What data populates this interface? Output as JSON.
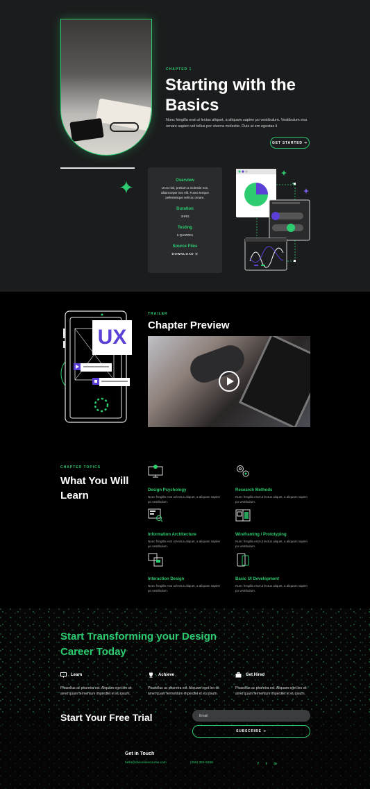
{
  "hero": {
    "eyebrow": "CHAPTER 1",
    "title_line1": "Starting with the",
    "title_line2": "Basics",
    "description": "Nunc fringilla erat ut lectus aliquet, a aliquam sapien po vestibulum. Vestibulum esa ornare sapien vel tellus por viverra molestie. Duis at em egestas li",
    "button_label": "GET STARTED ➔"
  },
  "details_card": {
    "overview_title": "Overview",
    "overview_text": "Ut ex nisl, pretium a molestie non, ullamcorper nec elit. Fusce tempor pellentesque velit ac ornare.",
    "duration_title": "Duration",
    "duration_value": "2HRS",
    "testing_title": "Testing",
    "testing_value": "5 QUIZZES",
    "source_title": "Source Files",
    "download_label": "DOWNLOAD ⊙"
  },
  "trailer": {
    "eyebrow": "TRAILER",
    "title": "Chapter Preview",
    "phone_badge": "UX"
  },
  "topics": {
    "eyebrow": "CHAPTER TOPICS",
    "title_line1": "What You Will",
    "title_line2": "Learn",
    "items": [
      {
        "title": "Design Psychology",
        "text": "Nunc fringilla erat ut lectus aliquet, a aliquam sapien po vestibulum.",
        "icon": "monitor-icon"
      },
      {
        "title": "Research Methods",
        "text": "Nunc fringilla erat ut lectus aliquet, a aliquam sapien po vestibulum.",
        "icon": "gears-icon"
      },
      {
        "title": "Information Architecture",
        "text": "Nunc fringilla erat ut lectus aliquet, a aliquam sapien po vestibulum.",
        "icon": "screen-search-icon"
      },
      {
        "title": "Wireframing / Prototyping",
        "text": "Nunc fringilla erat ut lectus aliquet, a aliquam sapien po vestibulum.",
        "icon": "wireframe-icon"
      },
      {
        "title": "Interaction Design",
        "text": "Nunc fringilla erat ut lectus aliquet, a aliquam sapien po vestibulum.",
        "icon": "devices-icon"
      },
      {
        "title": "Basic UI Development",
        "text": "Nunc fringilla erat ut lectus aliquet, a aliquam sapien po vestibulum.",
        "icon": "phone-icon"
      }
    ]
  },
  "cta": {
    "title_line1": "Start Transforming your Design",
    "title_line2": "Career Today",
    "features": [
      {
        "title": "Learn",
        "text": "Phasellus ac pharetra est. Aliquam eget leo sit amet quam fermentum imperdiet et eu ipsum.",
        "icon": "monitor-icon"
      },
      {
        "title": "Achieve",
        "text": "Phasellus ac pharetra est. Aliquam eget leo sit amet quam fermentum imperdiet et eu ipsum.",
        "icon": "trophy-icon"
      },
      {
        "title": "Get Hired",
        "text": "Phasellus ac pharetra est. Aliquam eget leo sit amet quam fermentum imperdiet et eu ipsum.",
        "icon": "briefcase-icon"
      }
    ],
    "trial_title": "Start Your Free Trial",
    "email_placeholder": "Email",
    "subscribe_label": "SUBSCRIBE ➔"
  },
  "footer": {
    "title": "Get in Touch",
    "email": "hello@divionlinecourse.com",
    "phone": "(255) 352-6258",
    "social": [
      "f",
      "t",
      "in"
    ]
  },
  "colors": {
    "accent": "#2ecc71",
    "purple": "#5b3fd6",
    "bg_dark": "#1b1c1d",
    "bg_black": "#000000"
  }
}
